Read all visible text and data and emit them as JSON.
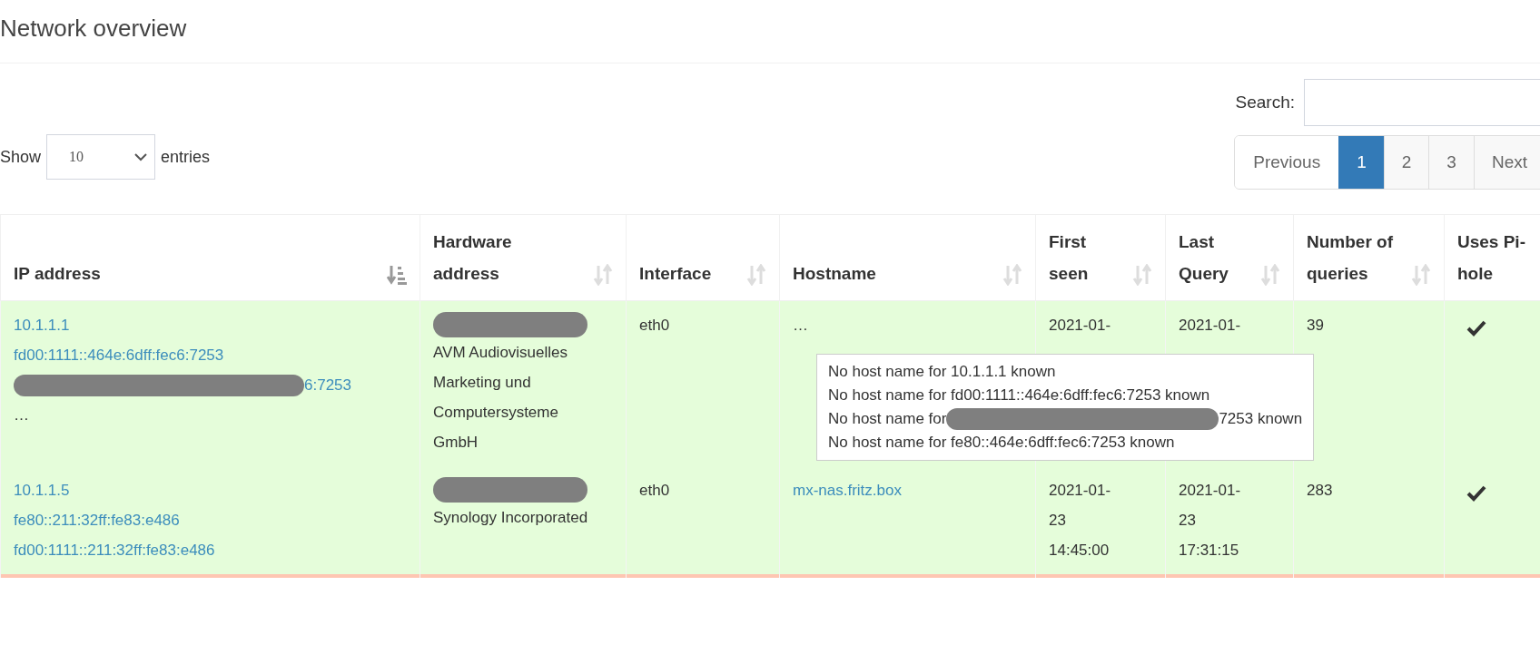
{
  "title": "Network overview",
  "search": {
    "label": "Search:"
  },
  "length": {
    "before": "Show",
    "value": "10",
    "after": "entries"
  },
  "pagination": [
    {
      "label": "Previous",
      "selected": false
    },
    {
      "label": "1",
      "selected": true
    },
    {
      "label": "2",
      "selected": false
    },
    {
      "label": "3",
      "selected": false
    },
    {
      "label": "Next",
      "selected": false
    }
  ],
  "table": {
    "columns": [
      {
        "label": "IP address",
        "sorted": true
      },
      {
        "label": "Hardware address",
        "sorted": false
      },
      {
        "label": "Interface",
        "sorted": false
      },
      {
        "label": "Hostname",
        "sorted": false
      },
      {
        "label": "First seen",
        "sorted": false
      },
      {
        "label": "Last Query",
        "sorted": false
      },
      {
        "label": "Number of queries",
        "sorted": false
      },
      {
        "label": "Uses Pi-hole"
      }
    ],
    "rows": [
      {
        "color": "#e5fdda",
        "ip": [
          {
            "text": "10.1.1.1",
            "kind": "link"
          },
          {
            "text": "fd00:1111::464e:6dff:fec6:7253",
            "kind": "link"
          },
          {
            "text": "6:7253",
            "kind": "link",
            "redacted": true
          },
          {
            "text": "…",
            "kind": "plain"
          }
        ],
        "hardware": {
          "redacted": true,
          "vendor": "AVM Audiovisuelles Marketing und Computersysteme GmbH"
        },
        "interface": "eth0",
        "hostname": {
          "text": "…",
          "kind": "plain"
        },
        "first_seen": [
          "2021-01-"
        ],
        "last_query": [
          "2021-01-"
        ],
        "queries": "39",
        "uses_pihole": true,
        "tooltip": [
          {
            "text": "No host name for 10.1.1.1 known"
          },
          {
            "text": "No host name for fd00:1111::464e:6dff:fec6:7253 known"
          },
          {
            "text": "No host name for",
            "redacted": true,
            "tail": "7253 known"
          },
          {
            "text": "No host name for fe80::464e:6dff:fec6:7253 known"
          }
        ]
      },
      {
        "color": "#e5fdda",
        "ip": [
          {
            "text": "10.1.1.5",
            "kind": "link"
          },
          {
            "text": "fe80::211:32ff:fe83:e486",
            "kind": "link"
          },
          {
            "text": "fd00:1111::211:32ff:fe83:e486",
            "kind": "link"
          }
        ],
        "hardware": {
          "redacted": true,
          "vendor": "Synology Incorporated"
        },
        "interface": "eth0",
        "hostname": {
          "text": "mx-nas.fritz.box",
          "kind": "link"
        },
        "first_seen": [
          "2021-01-",
          "23",
          "14:45:00"
        ],
        "last_query": [
          "2021-01-",
          "23",
          "17:31:15"
        ],
        "queries": "283",
        "uses_pihole": true
      },
      {
        "color": "#fec6b2"
      }
    ]
  }
}
